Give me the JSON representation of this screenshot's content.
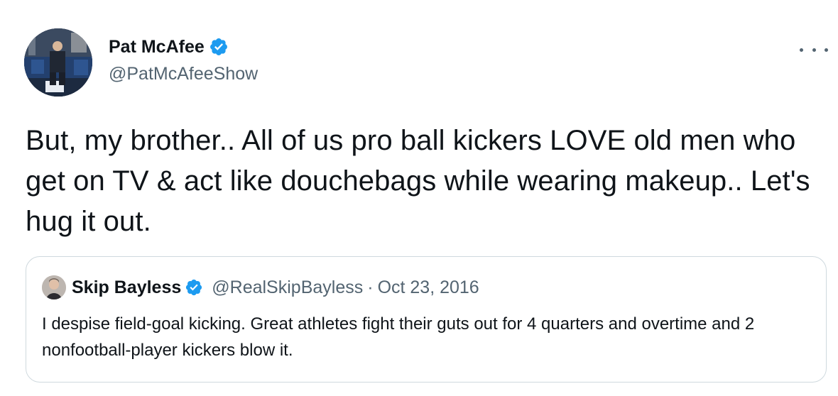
{
  "tweet": {
    "author": {
      "display_name": "Pat McAfee",
      "handle": "@PatMcAfeeShow",
      "verified": true
    },
    "text": "But, my brother.. All of us pro ball kickers LOVE old men who get on TV & act like douchebags while wearing makeup.. Let's hug it out.",
    "more_icon": "more-horizontal-icon"
  },
  "quoted_tweet": {
    "author": {
      "display_name": "Skip Bayless",
      "handle": "@RealSkipBayless",
      "verified": true
    },
    "separator": "·",
    "date": "Oct 23, 2016",
    "text": "I despise field-goal kicking. Great athletes fight their guts out for 4 quarters and overtime and 2 nonfootball-player kickers blow it."
  },
  "colors": {
    "text_primary": "#0f1419",
    "text_secondary": "#536471",
    "verified_blue": "#1d9bf0",
    "border": "#cfd9de"
  }
}
